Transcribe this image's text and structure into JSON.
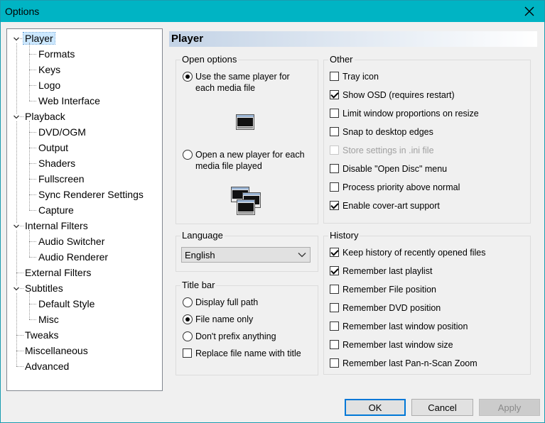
{
  "window": {
    "title": "Options"
  },
  "tree": {
    "items": [
      {
        "label": "Player",
        "level": 0,
        "expanded": true,
        "selected": true
      },
      {
        "label": "Formats",
        "level": 1
      },
      {
        "label": "Keys",
        "level": 1
      },
      {
        "label": "Logo",
        "level": 1
      },
      {
        "label": "Web Interface",
        "level": 1
      },
      {
        "label": "Playback",
        "level": 0,
        "expanded": true
      },
      {
        "label": "DVD/OGM",
        "level": 1
      },
      {
        "label": "Output",
        "level": 1
      },
      {
        "label": "Shaders",
        "level": 1
      },
      {
        "label": "Fullscreen",
        "level": 1
      },
      {
        "label": "Sync Renderer Settings",
        "level": 1
      },
      {
        "label": "Capture",
        "level": 1
      },
      {
        "label": "Internal Filters",
        "level": 0,
        "expanded": true
      },
      {
        "label": "Audio Switcher",
        "level": 1
      },
      {
        "label": "Audio Renderer",
        "level": 1
      },
      {
        "label": "External Filters",
        "level": 0
      },
      {
        "label": "Subtitles",
        "level": 0,
        "expanded": true
      },
      {
        "label": "Default Style",
        "level": 1
      },
      {
        "label": "Misc",
        "level": 1
      },
      {
        "label": "Tweaks",
        "level": 0
      },
      {
        "label": "Miscellaneous",
        "level": 0
      },
      {
        "label": "Advanced",
        "level": 0
      }
    ]
  },
  "panel": {
    "title": "Player"
  },
  "open_options": {
    "title": "Open options",
    "same_player": {
      "line1": "Use the same player for",
      "line2": "each media file",
      "checked": true
    },
    "new_player": {
      "line1": "Open a new player for each",
      "line2": "media file played",
      "checked": false
    }
  },
  "other": {
    "title": "Other",
    "items": [
      {
        "label": "Tray icon",
        "checked": false
      },
      {
        "label": "Show OSD (requires restart)",
        "checked": true
      },
      {
        "label": "Limit window proportions on resize",
        "checked": false
      },
      {
        "label": "Snap to desktop edges",
        "checked": false
      },
      {
        "label": "Store settings in .ini file",
        "checked": false,
        "disabled": true
      },
      {
        "label": "Disable \"Open Disc\" menu",
        "checked": false
      },
      {
        "label": "Process priority above normal",
        "checked": false
      },
      {
        "label": "Enable cover-art support",
        "checked": true
      }
    ]
  },
  "language": {
    "title": "Language",
    "selected": "English"
  },
  "title_bar": {
    "title": "Title bar",
    "options": [
      {
        "label": "Display full path",
        "checked": false
      },
      {
        "label": "File name only",
        "checked": true
      },
      {
        "label": "Don't prefix anything",
        "checked": false
      }
    ],
    "replace": {
      "label": "Replace file name with title",
      "checked": false
    }
  },
  "history": {
    "title": "History",
    "items": [
      {
        "label": "Keep history of recently opened files",
        "checked": true
      },
      {
        "label": "Remember last playlist",
        "checked": true
      },
      {
        "label": "Remember File position",
        "checked": false
      },
      {
        "label": "Remember DVD position",
        "checked": false
      },
      {
        "label": "Remember last window position",
        "checked": false
      },
      {
        "label": "Remember last window size",
        "checked": false
      },
      {
        "label": "Remember last Pan-n-Scan Zoom",
        "checked": false
      }
    ]
  },
  "buttons": {
    "ok": "OK",
    "cancel": "Cancel",
    "apply": "Apply"
  },
  "colors": {
    "titlebar": "#00b4c4",
    "selection": "#cce8ff",
    "accent": "#0078d7"
  }
}
